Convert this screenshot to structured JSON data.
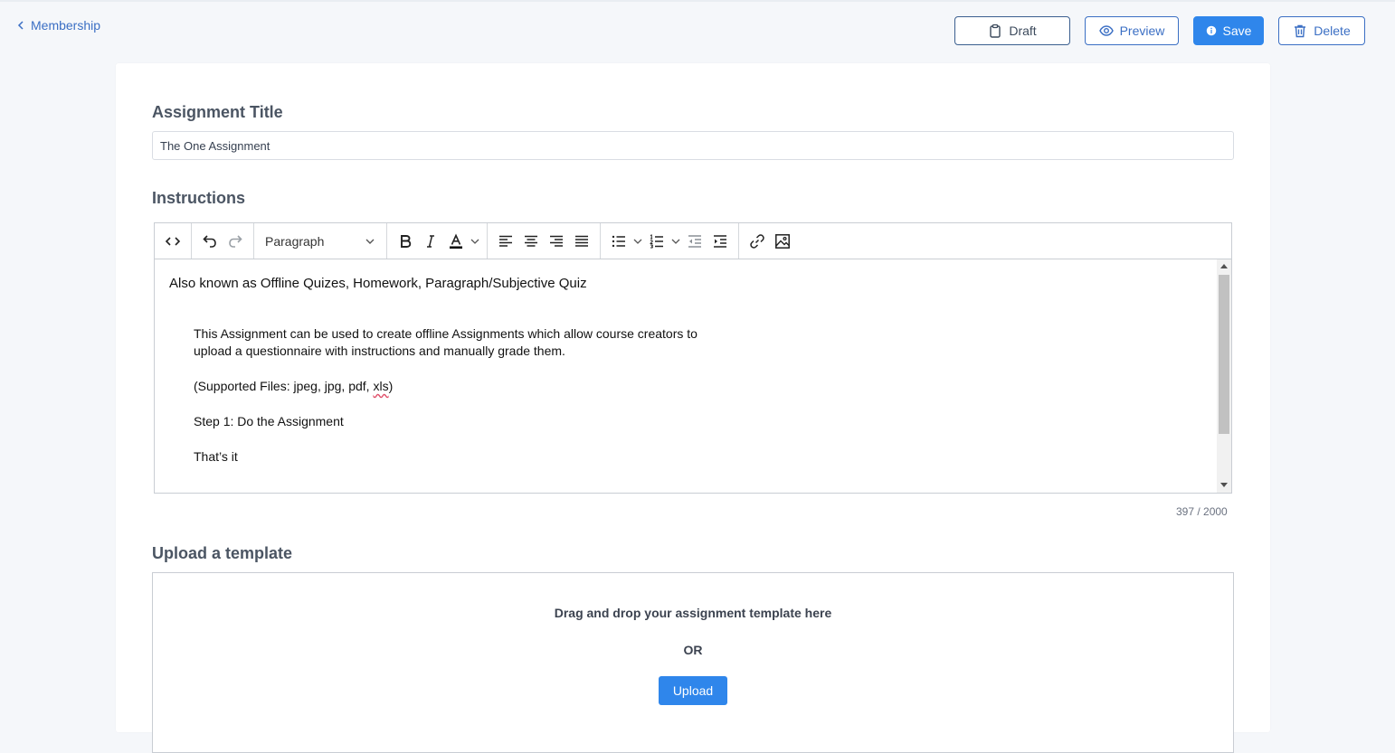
{
  "header": {
    "back_label": "Membership",
    "buttons": {
      "draft": "Draft",
      "preview": "Preview",
      "save": "Save",
      "delete": "Delete"
    }
  },
  "form": {
    "title_label": "Assignment Title",
    "title_value": "The One Assignment",
    "instructions_label": "Instructions",
    "toolbar": {
      "block_format": "Paragraph"
    },
    "instructions": {
      "line1": "Also known as Offline Quizes, Homework, Paragraph/Subjective Quiz",
      "line2": "This Assignment can be used to create offline Assignments which allow course creators to",
      "line3": "upload a questionnaire with instructions and manually grade them.",
      "line4_pre": "(Supported Files: jpeg, jpg, pdf, ",
      "line4_err": "xls",
      "line4_post": ")",
      "line5": "Step 1: Do the Assignment",
      "line6": "That’s it"
    },
    "char_count": "397 / 2000",
    "upload": {
      "label": "Upload a template",
      "drop_text": "Drag and drop your assignment template here",
      "or_text": "OR",
      "button": "Upload"
    }
  },
  "colors": {
    "accent": "#2f86eb",
    "link": "#3b6fc4",
    "background": "#f5f7fa"
  }
}
